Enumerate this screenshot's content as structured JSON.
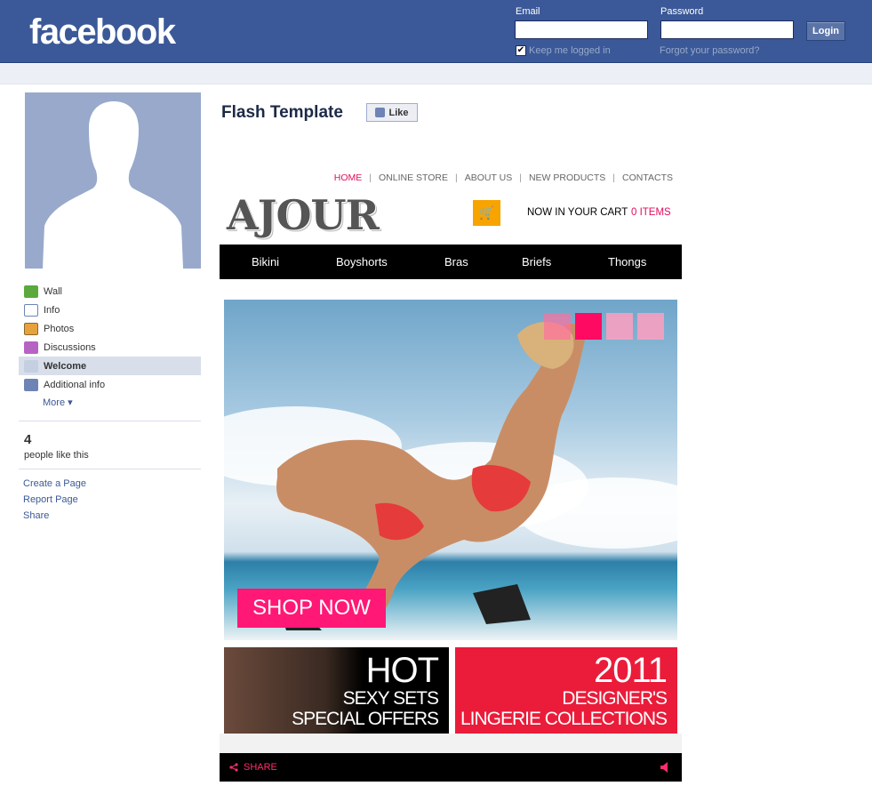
{
  "header": {
    "logo": "facebook",
    "email_label": "Email",
    "password_label": "Password",
    "email_value": "",
    "password_value": "",
    "login_label": "Login",
    "keep_logged_in": "Keep me logged in",
    "forgot_password": "Forgot your password?"
  },
  "sidebar": {
    "items": [
      {
        "label": "Wall",
        "icon": "wall-icon"
      },
      {
        "label": "Info",
        "icon": "info-icon"
      },
      {
        "label": "Photos",
        "icon": "photos-icon"
      },
      {
        "label": "Discussions",
        "icon": "discussions-icon"
      },
      {
        "label": "Welcome",
        "icon": "welcome-icon",
        "active": true
      },
      {
        "label": "Additional info",
        "icon": "additional-info-icon"
      }
    ],
    "more": "More",
    "likes_count": "4",
    "likes_text": "people like this",
    "links": [
      "Create a Page",
      "Report Page",
      "Share"
    ]
  },
  "page": {
    "title": "Flash Template",
    "like_label": "Like"
  },
  "ajour": {
    "nav": [
      "HOME",
      "ONLINE STORE",
      "ABOUT US",
      "NEW PRODUCTS",
      "CONTACTS"
    ],
    "brand": "AJOUR",
    "cart_text": "NOW IN YOUR CART",
    "cart_items": "0 ITEMS",
    "categories": [
      "Bikini",
      "Boyshorts",
      "Bras",
      "Briefs",
      "Thongs"
    ],
    "shop_now": "SHOP NOW",
    "promo1": {
      "big": "HOT",
      "l2": "SEXY SETS",
      "l3": "SPECIAL OFFERS"
    },
    "promo2": {
      "big": "2011",
      "l2": "DESIGNER'S",
      "l3": "LINGERIE COLLECTIONS"
    },
    "share": "SHARE"
  },
  "colors": {
    "facebook_blue": "#3b5998",
    "accent_pink": "#e30b5d",
    "cart_orange": "#f7a400",
    "promo_red": "#ea1c3a"
  }
}
